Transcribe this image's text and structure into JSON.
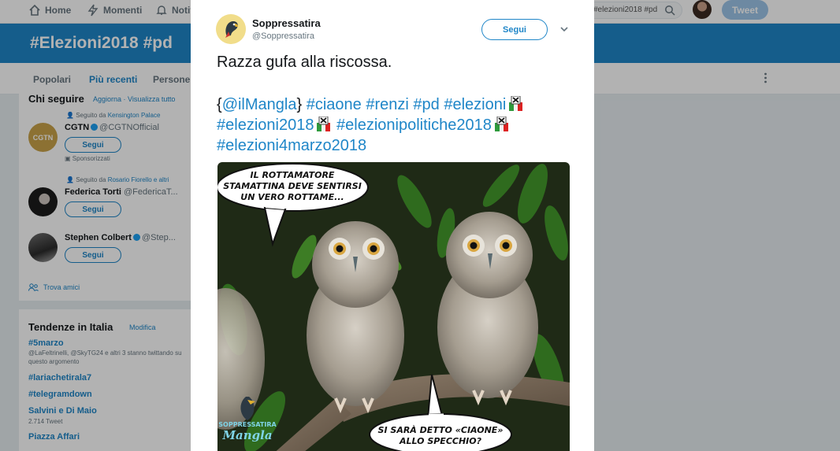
{
  "nav": {
    "home": "Home",
    "moments": "Momenti",
    "notifications": "Notifi",
    "search_value": "#elezioni2018 #pd",
    "tweet_button": "Tweet"
  },
  "banner": {
    "title": "#Elezioni2018 #pd"
  },
  "tabs": [
    "Popolari",
    "Più recenti",
    "Persone"
  ],
  "who_to_follow": {
    "title": "Chi seguire",
    "refresh": "Aggiorna",
    "view_all": "Visualizza tutto",
    "people": [
      {
        "context_prefix": "Seguito da",
        "context_link": "Kensington Palace",
        "name": "CGTN",
        "handle": "@CGTNOfficial",
        "verified": true,
        "follow": "Segui",
        "sponsored": "Sponsorizzati"
      },
      {
        "context_prefix": "Seguito da",
        "context_link": "Rosario Fiorello e altri",
        "name": "Federica Torti",
        "handle": "@FedericaT...",
        "verified": false,
        "follow": "Segui"
      },
      {
        "context_prefix": "",
        "context_link": "",
        "name": "Stephen Colbert",
        "handle": "@Step...",
        "verified": true,
        "follow": "Segui"
      }
    ],
    "find_friends": "Trova amici"
  },
  "trends": {
    "title": "Tendenze in Italia",
    "change": "Modifica",
    "items": [
      {
        "tag": "#5marzo",
        "desc": "@LaFeltrinelli, @SkyTG24 e altri 3 stanno twittando su questo argomento"
      },
      {
        "tag": "#lariachetirala7",
        "desc": ""
      },
      {
        "tag": "#telegramdown",
        "desc": ""
      },
      {
        "tag": "Salvini e Di Maio",
        "desc": "2.714 Tweet"
      },
      {
        "tag": "Piazza Affari",
        "desc": ""
      }
    ]
  },
  "tweet": {
    "author_name": "Soppressatira",
    "author_handle": "@Soppressatira",
    "follow": "Segui",
    "text": "Razza gufa alla riscossa.",
    "brace_open": "{",
    "mention": "@ilMangla",
    "brace_close": "}",
    "hashtags_line1": [
      "#ciaone",
      "#renzi",
      "#pd",
      "#elezioni"
    ],
    "hashtags_line2": [
      "#elezioni2018",
      "#elezionipolitiche2018"
    ],
    "hashtags_line3": [
      "#elezioni4marzo2018"
    ],
    "image": {
      "bubble_top": [
        "IL ROTTAMATORE",
        "STAMATTINA DEVE SENTIRSI",
        "UN VERO ROTTAME..."
      ],
      "bubble_bottom": [
        "SI SARÀ DETTO «CIAONE»",
        "ALLO SPECCHIO?"
      ],
      "logo_top": "SOPPRESSATIRA",
      "logo_bottom": "Mangla"
    }
  },
  "colors": {
    "accent": "#1f86c8",
    "banner": "#1f86c8"
  }
}
